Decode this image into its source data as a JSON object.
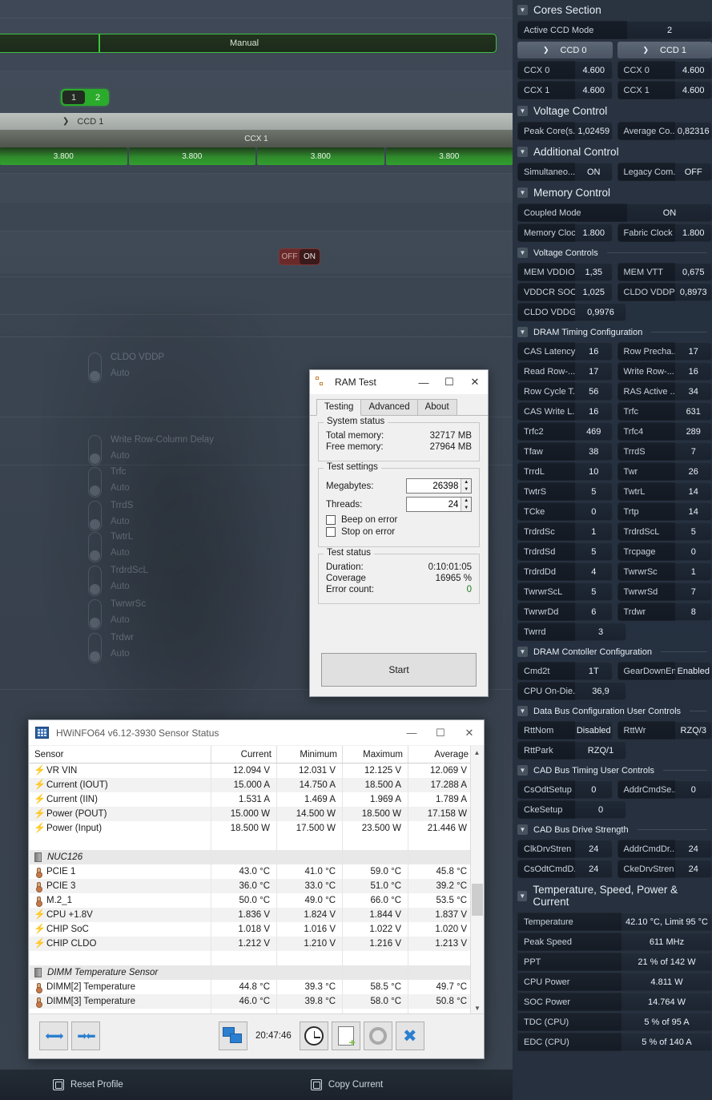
{
  "ryzen_master": {
    "manual_bar_label": "Manual",
    "ccd_segmented": {
      "option_1": "1",
      "option_2": "2",
      "selected": "2"
    },
    "ccd_header": "CCD 1",
    "ccx_header": "CCX 1",
    "core_values": [
      "3.800",
      "3.800",
      "3.800",
      "3.800"
    ],
    "onoff_toggle": {
      "off": "OFF",
      "on": "ON",
      "selected": "ON"
    },
    "dimmed_rows": [
      {
        "name": "CLDO VDDP",
        "value": "Auto"
      },
      {
        "name": "Write Row-Column Delay",
        "value": "Auto"
      },
      {
        "name": "Trfc",
        "value": "Auto"
      },
      {
        "name": "TrrdS",
        "value": "Auto"
      },
      {
        "name": "TwtrL",
        "value": "Auto"
      },
      {
        "name": "TrdrdScL",
        "value": "Auto"
      },
      {
        "name": "TwrwrSc",
        "value": "Auto"
      },
      {
        "name": "Trdwr",
        "value": "Auto"
      }
    ],
    "bottom_bar": {
      "reset_profile": "Reset Profile",
      "copy_current": "Copy Current"
    }
  },
  "right_panel": {
    "cores_section": {
      "title": "Cores Section",
      "active_ccd_mode": {
        "label": "Active CCD Mode",
        "value": "2"
      },
      "ccd0": {
        "header": "CCD 0",
        "rows": [
          {
            "k": "CCX 0",
            "v": "4.600"
          },
          {
            "k": "CCX 1",
            "v": "4.600"
          }
        ]
      },
      "ccd1": {
        "header": "CCD 1",
        "rows": [
          {
            "k": "CCX 0",
            "v": "4.600"
          },
          {
            "k": "CCX 1",
            "v": "4.600"
          }
        ]
      }
    },
    "voltage_control": {
      "title": "Voltage Control",
      "cells": [
        {
          "k": "Peak Core(s...",
          "v": "1,02459"
        },
        {
          "k": "Average Co...",
          "v": "0,82316"
        }
      ]
    },
    "additional_control": {
      "title": "Additional Control",
      "cells": [
        {
          "k": "Simultaneo...",
          "v": "ON"
        },
        {
          "k": "Legacy Com...",
          "v": "OFF"
        }
      ]
    },
    "memory_control": {
      "title": "Memory Control",
      "coupled_mode": {
        "label": "Coupled Mode",
        "value": "ON"
      },
      "clocks": [
        {
          "k": "Memory Clock",
          "v": "1.800"
        },
        {
          "k": "Fabric Clock",
          "v": "1.800"
        }
      ]
    },
    "voltage_controls": {
      "title": "Voltage Controls",
      "cells": [
        {
          "k": "MEM VDDIO",
          "v": "1,35"
        },
        {
          "k": "MEM VTT",
          "v": "0,675"
        },
        {
          "k": "VDDCR SOC",
          "v": "1,025"
        },
        {
          "k": "CLDO VDDP",
          "v": "0,8973"
        },
        {
          "k": "CLDO VDDG",
          "v": "0,9976"
        }
      ]
    },
    "dram_timing": {
      "title": "DRAM Timing Configuration",
      "cells": [
        {
          "k": "CAS Latency",
          "v": "16"
        },
        {
          "k": "Row Precha...",
          "v": "17"
        },
        {
          "k": "Read Row-...",
          "v": "17"
        },
        {
          "k": "Write Row-...",
          "v": "16"
        },
        {
          "k": "Row Cycle T...",
          "v": "56"
        },
        {
          "k": "RAS Active ...",
          "v": "34"
        },
        {
          "k": "CAS Write L...",
          "v": "16"
        },
        {
          "k": "Trfc",
          "v": "631"
        },
        {
          "k": "Trfc2",
          "v": "469"
        },
        {
          "k": "Trfc4",
          "v": "289"
        },
        {
          "k": "Tfaw",
          "v": "38"
        },
        {
          "k": "TrrdS",
          "v": "7"
        },
        {
          "k": "TrrdL",
          "v": "10"
        },
        {
          "k": "Twr",
          "v": "26"
        },
        {
          "k": "TwtrS",
          "v": "5"
        },
        {
          "k": "TwtrL",
          "v": "14"
        },
        {
          "k": "TCke",
          "v": "0"
        },
        {
          "k": "Trtp",
          "v": "14"
        },
        {
          "k": "TrdrdSc",
          "v": "1"
        },
        {
          "k": "TrdrdScL",
          "v": "5"
        },
        {
          "k": "TrdrdSd",
          "v": "5"
        },
        {
          "k": "Trcpage",
          "v": "0"
        },
        {
          "k": "TrdrdDd",
          "v": "4"
        },
        {
          "k": "TwrwrSc",
          "v": "1"
        },
        {
          "k": "TwrwrScL",
          "v": "5"
        },
        {
          "k": "TwrwrSd",
          "v": "7"
        },
        {
          "k": "TwrwrDd",
          "v": "6"
        },
        {
          "k": "Trdwr",
          "v": "8"
        },
        {
          "k": "Twrrd",
          "v": "3"
        }
      ]
    },
    "dram_controller": {
      "title": "DRAM Contoller Configuration",
      "cells": [
        {
          "k": "Cmd2t",
          "v": "1T"
        },
        {
          "k": "GearDownEn",
          "v": "Enabled"
        },
        {
          "k": "CPU On-Die...",
          "v": "36,9"
        }
      ]
    },
    "data_bus": {
      "title": "Data Bus Configuration User Controls",
      "cells": [
        {
          "k": "RttNom",
          "v": "Disabled"
        },
        {
          "k": "RttWr",
          "v": "RZQ/3"
        },
        {
          "k": "RttPark",
          "v": "RZQ/1"
        }
      ]
    },
    "cad_bus_timing": {
      "title": "CAD Bus Timing User Controls",
      "cells": [
        {
          "k": "CsOdtSetup",
          "v": "0"
        },
        {
          "k": "AddrCmdSe...",
          "v": "0"
        },
        {
          "k": "CkeSetup",
          "v": "0"
        }
      ]
    },
    "cad_bus_drive": {
      "title": "CAD Bus Drive Strength",
      "cells": [
        {
          "k": "ClkDrvStren",
          "v": "24"
        },
        {
          "k": "AddrCmdDr...",
          "v": "24"
        },
        {
          "k": "CsOdtCmdD...",
          "v": "24"
        },
        {
          "k": "CkeDrvStren",
          "v": "24"
        }
      ]
    },
    "temp_speed_power": {
      "title": "Temperature, Speed, Power & Current",
      "rows": [
        {
          "k": "Temperature",
          "v": "42.10 °C, Limit 95 °C"
        },
        {
          "k": "Peak Speed",
          "v": "611 MHz"
        },
        {
          "k": "PPT",
          "v": "21 % of 142 W"
        },
        {
          "k": "CPU Power",
          "v": "4.811 W"
        },
        {
          "k": "SOC Power",
          "v": "14.764 W"
        },
        {
          "k": "TDC (CPU)",
          "v": "5 % of 95 A"
        },
        {
          "k": "EDC (CPU)",
          "v": "5 % of 140 A"
        }
      ]
    }
  },
  "ram_test": {
    "title": "RAM Test",
    "window_buttons": {
      "minimize": "—",
      "maximize": "☐",
      "close": "✕"
    },
    "tabs": [
      {
        "label": "Testing",
        "active": true
      },
      {
        "label": "Advanced",
        "active": false
      },
      {
        "label": "About",
        "active": false
      }
    ],
    "system_status": {
      "caption": "System status",
      "total_memory_label": "Total memory:",
      "total_memory_value": "32717 MB",
      "free_memory_label": "Free memory:",
      "free_memory_value": "27964 MB"
    },
    "test_settings": {
      "caption": "Test settings",
      "megabytes_label": "Megabytes:",
      "megabytes_value": "26398",
      "threads_label": "Threads:",
      "threads_value": "24",
      "beep_on_error": "Beep on error",
      "stop_on_error": "Stop on error"
    },
    "test_status": {
      "caption": "Test status",
      "duration_label": "Duration:",
      "duration_value": "0:10:01:05",
      "coverage_label": "Coverage",
      "coverage_value": "16965 %",
      "error_count_label": "Error count:",
      "error_count_value": "0"
    },
    "start_button": "Start"
  },
  "hwinfo": {
    "title": "HWiNFO64 v6.12-3930 Sensor Status",
    "window_buttons": {
      "minimize": "—",
      "maximize": "☐",
      "close": "✕"
    },
    "columns": [
      "Sensor",
      "Current",
      "Minimum",
      "Maximum",
      "Average"
    ],
    "rows": [
      {
        "type": "data",
        "icon": "voltage-icon",
        "name": "VR VIN",
        "current": "12.094 V",
        "minimum": "12.031 V",
        "maximum": "12.125 V",
        "average": "12.069 V"
      },
      {
        "type": "data",
        "icon": "voltage-icon",
        "name": "Current (IOUT)",
        "current": "15.000 A",
        "minimum": "14.750 A",
        "maximum": "18.500 A",
        "average": "17.288 A"
      },
      {
        "type": "data",
        "icon": "voltage-icon",
        "name": "Current (IIN)",
        "current": "1.531 A",
        "minimum": "1.469 A",
        "maximum": "1.969 A",
        "average": "1.789 A"
      },
      {
        "type": "data",
        "icon": "voltage-icon",
        "name": "Power (POUT)",
        "current": "15.000 W",
        "minimum": "14.500 W",
        "maximum": "18.500 W",
        "average": "17.158 W"
      },
      {
        "type": "data",
        "icon": "voltage-icon",
        "name": "Power (Input)",
        "current": "18.500 W",
        "minimum": "17.500 W",
        "maximum": "23.500 W",
        "average": "21.446 W"
      },
      {
        "type": "blank"
      },
      {
        "type": "group",
        "icon": "chip-icon",
        "name": "NUC126"
      },
      {
        "type": "data",
        "icon": "temperature-icon",
        "name": "PCIE 1",
        "current": "43.0 °C",
        "minimum": "41.0 °C",
        "maximum": "59.0 °C",
        "average": "45.8 °C"
      },
      {
        "type": "data",
        "icon": "temperature-icon",
        "name": "PCIE 3",
        "current": "36.0 °C",
        "minimum": "33.0 °C",
        "maximum": "51.0 °C",
        "average": "39.2 °C"
      },
      {
        "type": "data",
        "icon": "temperature-icon",
        "name": "M.2_1",
        "current": "50.0 °C",
        "minimum": "49.0 °C",
        "maximum": "66.0 °C",
        "average": "53.5 °C"
      },
      {
        "type": "data",
        "icon": "voltage-icon",
        "name": "CPU +1.8V",
        "current": "1.836 V",
        "minimum": "1.824 V",
        "maximum": "1.844 V",
        "average": "1.837 V"
      },
      {
        "type": "data",
        "icon": "voltage-icon",
        "name": "CHIP SoC",
        "current": "1.018 V",
        "minimum": "1.016 V",
        "maximum": "1.022 V",
        "average": "1.020 V"
      },
      {
        "type": "data",
        "icon": "voltage-icon",
        "name": "CHIP CLDO",
        "current": "1.212 V",
        "minimum": "1.210 V",
        "maximum": "1.216 V",
        "average": "1.213 V"
      },
      {
        "type": "blank"
      },
      {
        "type": "group",
        "icon": "chip-icon",
        "name": "DIMM Temperature Sensor"
      },
      {
        "type": "data",
        "icon": "temperature-icon",
        "name": "DIMM[2] Temperature",
        "current": "44.8 °C",
        "minimum": "39.3 °C",
        "maximum": "58.5 °C",
        "average": "49.7 °C"
      },
      {
        "type": "data",
        "icon": "temperature-icon",
        "name": "DIMM[3] Temperature",
        "current": "46.0 °C",
        "minimum": "39.8 °C",
        "maximum": "58.0 °C",
        "average": "50.8 °C"
      },
      {
        "type": "blank"
      }
    ],
    "footer": {
      "clock_value": "20:47:46"
    }
  }
}
